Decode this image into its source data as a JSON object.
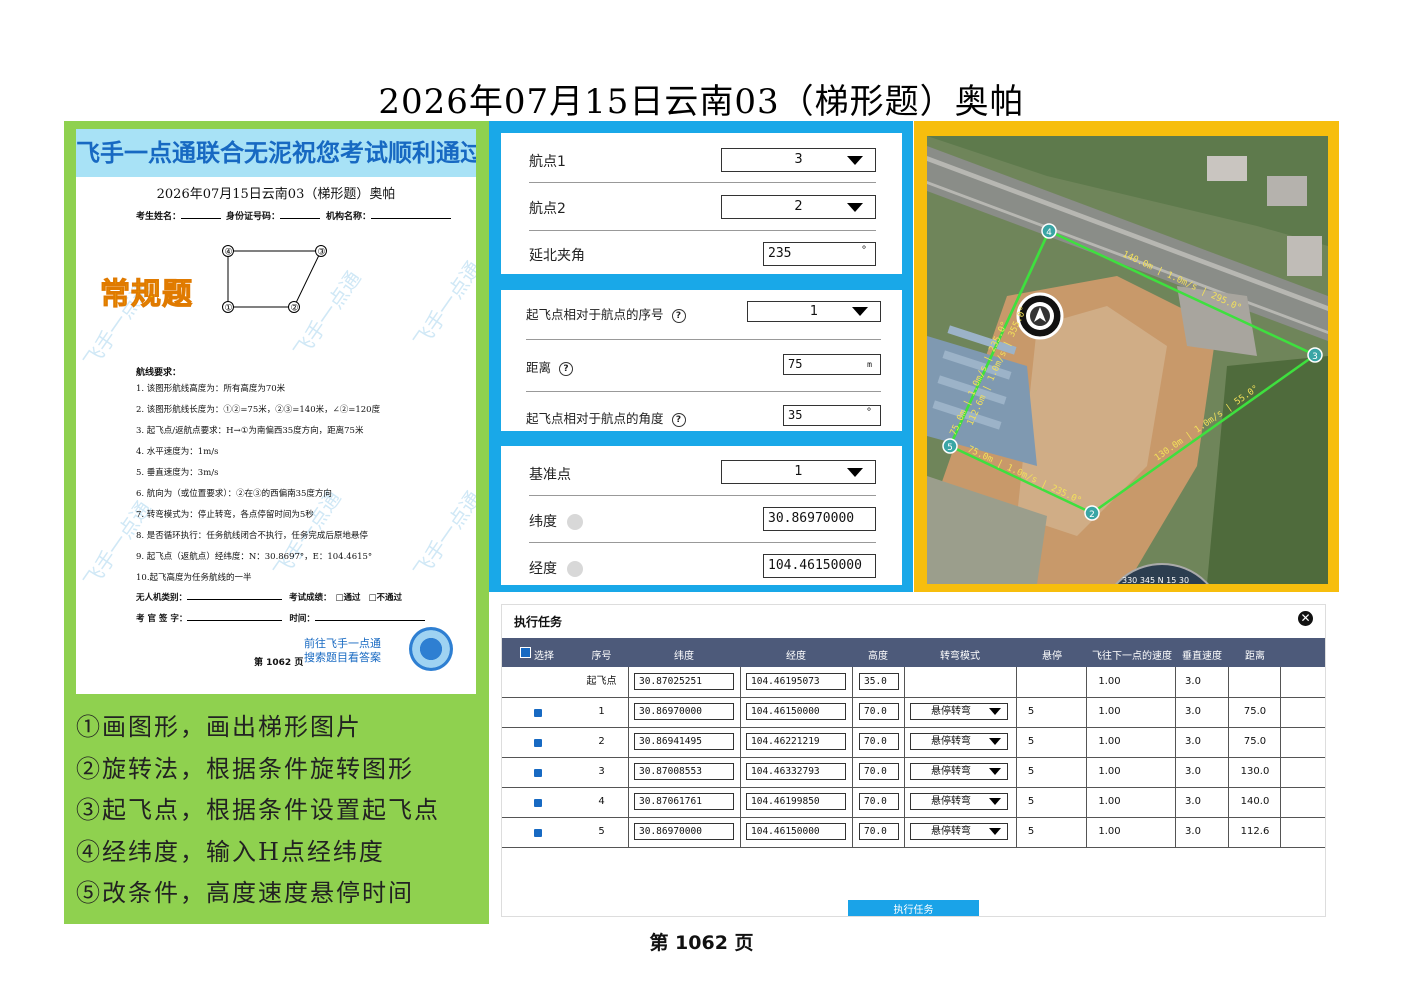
{
  "title": "2026年07月15日云南03（梯形题）奥帕",
  "sheet": {
    "banner": "飞手一点通联合无泥祝您考试顺利通过",
    "title": "2026年07月15日云南03（梯形题）奥帕",
    "fields": [
      "考生姓名：",
      "身份证号码：",
      "机构名称："
    ],
    "routine": "常规题",
    "diagram_points": [
      "④",
      "③",
      "①",
      "②"
    ],
    "req_title": "航线要求：",
    "requirements": [
      "1. 该图形航线高度为：所有高度为70米",
      "2. 该图形航线长度为：①②=75米，②③=140米，∠②=120度",
      "3. 起飞点/返航点要求：H→①为南偏西35度方向，距离75米",
      "4. 水平速度为：1m/s",
      "5. 垂直速度为：3m/s",
      "6. 航向为（或位置要求）：②在③的西偏南35度方向",
      "7. 转弯模式为：停止转弯，各点停留时间为5秒",
      "8. 是否循环执行：任务航线闭合不执行，任务完成后原地悬停",
      "9. 起飞点（返航点）经纬度：N：30.8697°，E：104.4615°",
      "10.起飞高度为任务航线的一半"
    ],
    "uav_type": "无人机类别：",
    "result": "考试成绩：",
    "pass": "□通过",
    "fail": "□不通过",
    "examiner": "考 官 签 字：",
    "time": "时间：",
    "goto1": "前往飞手一点通",
    "goto2": "搜索题目看答案",
    "page": "第 1062 页",
    "watermark": "飞手一点通"
  },
  "steps": [
    "①画图形，画出梯形图片",
    "②旋转法，根据条件旋转图形",
    "③起飞点，根据条件设置起飞点",
    "④经纬度，输入H点经纬度",
    "⑤改条件，高度速度悬停时间"
  ],
  "form1": {
    "waypoint1_label": "航点1",
    "waypoint1_value": "3",
    "waypoint2_label": "航点2",
    "waypoint2_value": "2",
    "angle_label": "延北夹角",
    "angle_value": "235",
    "angle_unit": "°"
  },
  "form2": {
    "seq_label": "起飞点相对于航点的序号",
    "seq_value": "1",
    "dist_label": "距离",
    "dist_value": "75",
    "dist_unit": "m",
    "ang_label": "起飞点相对于航点的角度",
    "ang_value": "35",
    "ang_unit": "°"
  },
  "form3": {
    "base_label": "基准点",
    "base_value": "1",
    "lat_label": "纬度",
    "lat_value": "30.86970000",
    "lon_label": "经度",
    "lon_value": "104.46150000"
  },
  "map": {
    "labels": {
      "seg43": "140.0m | 1.0m/s | 295.0°",
      "seg32": "130.0m | 1.0m/s | 55.0°",
      "seg25": "75.0m | 1.0m/s | 235.0°",
      "seg51": "75.0m | 1.0m/s | 235.0°",
      "seg14": "112.6m | 1.0m/s | 355.0°"
    },
    "points": [
      "1",
      "2",
      "3",
      "4",
      "5"
    ],
    "compass": "330 345 N 15 30"
  },
  "task": {
    "title": "执行任务",
    "close": "✕",
    "headers": [
      "选择",
      "序号",
      "纬度",
      "经度",
      "高度",
      "转弯模式",
      "悬停",
      "飞往下一点的速度",
      "垂直速度",
      "距离"
    ],
    "rows": [
      {
        "seq": "起飞点",
        "lat": "30.87025251",
        "lon": "104.46195073",
        "alt": "35.0",
        "mode": "",
        "hover": "",
        "speed": "1.00",
        "vspeed": "3.0",
        "dist": "",
        "checked": false
      },
      {
        "seq": "1",
        "lat": "30.86970000",
        "lon": "104.46150000",
        "alt": "70.0",
        "mode": "悬停转弯",
        "hover": "5",
        "speed": "1.00",
        "vspeed": "3.0",
        "dist": "75.0",
        "checked": true
      },
      {
        "seq": "2",
        "lat": "30.86941495",
        "lon": "104.46221219",
        "alt": "70.0",
        "mode": "悬停转弯",
        "hover": "5",
        "speed": "1.00",
        "vspeed": "3.0",
        "dist": "75.0",
        "checked": true
      },
      {
        "seq": "3",
        "lat": "30.87008553",
        "lon": "104.46332793",
        "alt": "70.0",
        "mode": "悬停转弯",
        "hover": "5",
        "speed": "1.00",
        "vspeed": "3.0",
        "dist": "130.0",
        "checked": true
      },
      {
        "seq": "4",
        "lat": "30.87061761",
        "lon": "104.46199850",
        "alt": "70.0",
        "mode": "悬停转弯",
        "hover": "5",
        "speed": "1.00",
        "vspeed": "3.0",
        "dist": "140.0",
        "checked": true
      },
      {
        "seq": "5",
        "lat": "30.86970000",
        "lon": "104.46150000",
        "alt": "70.0",
        "mode": "悬停转弯",
        "hover": "5",
        "speed": "1.00",
        "vspeed": "3.0",
        "dist": "112.6",
        "checked": true
      }
    ],
    "exec_button": "执行任务"
  },
  "footer": "第 1062 页",
  "colors": {
    "green_panel": "#8fd14f",
    "blue_panel": "#19a8e8",
    "yellow_panel": "#f7be0d",
    "table_header": "#4d5a7a",
    "route": "#3ee03e"
  }
}
